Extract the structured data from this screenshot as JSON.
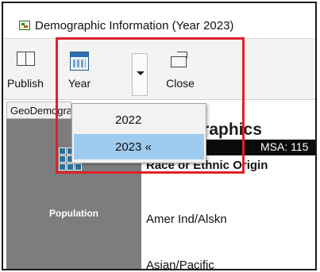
{
  "window": {
    "title": "Demographic Information (Year 2023)"
  },
  "toolbar": {
    "publish_label": "Publish",
    "year_label": "Year",
    "close_label": "Close"
  },
  "tab": {
    "label": "GeoDemographics"
  },
  "sidebar": {
    "population_label": "Population"
  },
  "report": {
    "title": "Demographics",
    "msa_text": "MSA: 115",
    "race_header": "Race or Ethnic Origin",
    "rows": [
      "Amer Ind/Alskn",
      "Asian/Pacific"
    ]
  },
  "year_menu": {
    "items": [
      {
        "label": "2022",
        "selected": false
      },
      {
        "label": "2023 «",
        "selected": true
      }
    ]
  },
  "colors": {
    "highlight": "#e0202a",
    "selected_item": "#9fcbef"
  }
}
